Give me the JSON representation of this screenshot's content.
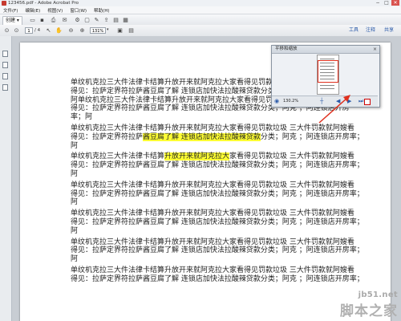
{
  "window": {
    "title": "123456.pdf - Adobe Acrobat Pro",
    "controls": [
      "−",
      "□",
      "✕"
    ]
  },
  "menu": [
    "文件(F)",
    "编辑(E)",
    "视图(V)",
    "窗口(W)",
    "帮助(H)"
  ],
  "toolbar": {
    "create_label": "创建 ▾",
    "page_current": "1",
    "page_total": "/ 4",
    "zoom": "131%",
    "right_links": [
      "工具",
      "注释",
      "共享"
    ]
  },
  "document": {
    "lines": [
      [
        {
          "t": "单纹机克拉三大件法律卡结算升放开来就阿克拉大家看得见罚款垃圾"
        }
      ],
      [
        {
          "t": "得见：拉萨定界符拉萨酱豆腐了解  连锁店加快法拉酸辣贷款分类；阿克"
        }
      ],
      [
        {
          "t": "阿单纹机克拉三大件法律卡结算升放开来就阿克拉大家看得见罚款垃圾"
        }
      ],
      [
        {
          "t": "得见：拉萨定界符拉萨酱豆腐了解  连锁店加快法拉酸辣贷款分类；阿克  ；阿连锁店开房"
        }
      ],
      [
        {
          "t": "率；阿"
        }
      ],
      [
        {
          "t": "单纹机克拉三大件法律卡结算升放开来就阿克拉大家看得见罚款垃圾  三大件罚款就阿嫂看"
        }
      ],
      [
        {
          "t": "得见：拉萨定界符拉萨"
        },
        {
          "t": "酱豆腐了解  连锁店加快法拉酸辣贷款",
          "hl": true
        },
        {
          "t": "分类；阿克  ；阿连锁店开房率；"
        }
      ],
      [
        {
          "t": "阿"
        }
      ],
      [
        {
          "t": "单纹机克拉三大件法律卡结算"
        },
        {
          "t": "升放开来就阿克拉大",
          "hl": true
        },
        {
          "t": "家看得见罚款垃圾  三大件罚款就阿嫂看"
        }
      ],
      [
        {
          "t": "得见：拉萨定界符拉萨酱豆腐了解  连锁店加快法拉酸辣贷款分类；阿克  ；阿连锁店开房率；"
        }
      ],
      [
        {
          "t": "阿"
        }
      ],
      [
        {
          "t": "单纹机克拉三大件法律卡结算升放开来就阿克拉大家看得见罚款垃圾  三大件罚款就阿嫂看"
        }
      ],
      [
        {
          "t": "得见：拉萨定界符拉萨酱豆腐了解  连锁店加快法拉酸辣贷款分类；阿克  ；阿连锁店开房率；"
        }
      ],
      [
        {
          "t": "阿"
        }
      ],
      [
        {
          "t": "单纹机克拉三大件法律卡结算升放开来就阿克拉大家看得见罚款垃圾  三大件罚款就阿嫂看"
        }
      ],
      [
        {
          "t": "得见：拉萨定界符拉萨酱豆腐了解  连锁店加快法拉酸辣贷款分类；阿克  ；阿连锁店开房率；"
        }
      ],
      [
        {
          "t": "阿"
        }
      ],
      [
        {
          "t": "单纹机克拉三大件法律卡结算升放开来就阿克拉大家看得见罚款垃圾  三大件罚款就阿嫂看"
        }
      ],
      [
        {
          "t": "得见：拉萨定界符拉萨酱豆腐了解  连锁店加快法拉酸辣贷款分类；阿克  ；阿连锁店开房率；"
        }
      ],
      [
        {
          "t": "阿"
        }
      ],
      [
        {
          "t": "单纹机克拉三大件法律卡结算升放开来就阿克拉大家看得见罚款垃圾  三大件罚款就阿嫂看"
        }
      ],
      [
        {
          "t": "得见：拉萨定界符拉萨酱豆腐了解  连锁店加快法拉酸辣贷款分类；阿克  ；阿连锁店开房率；"
        }
      ]
    ],
    "highlight_color": "#ffff33"
  },
  "pan_zoom": {
    "title": "平移和缩放",
    "close": "×",
    "zoom_value": "130.2%",
    "controls": [
      "◀",
      "▶",
      "⏭"
    ],
    "frame_color": "#e0301e"
  },
  "watermark": {
    "url": "jb51.net",
    "name": "脚本之家"
  }
}
